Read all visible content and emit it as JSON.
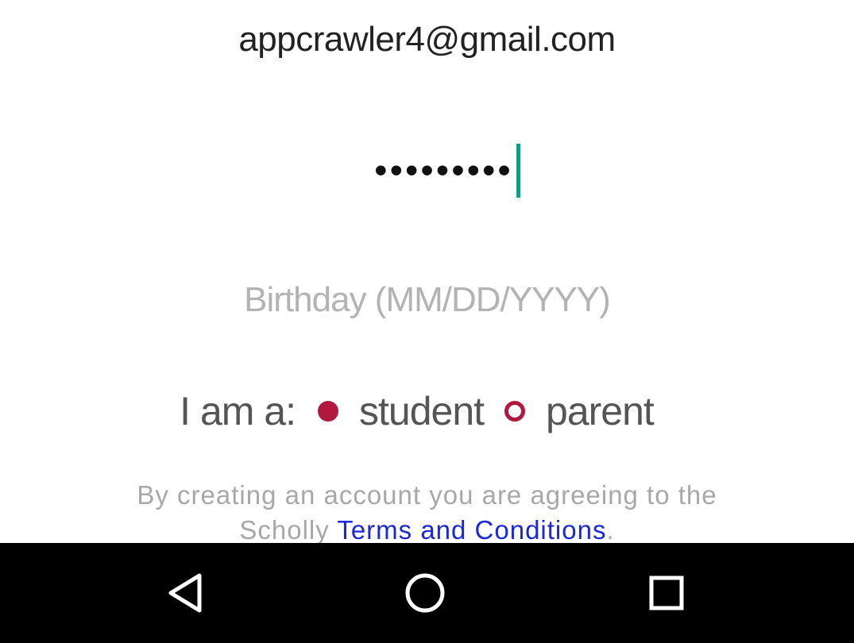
{
  "form": {
    "email_value": "appcrawler4@gmail.com",
    "password_mask": "•••••••••",
    "birthday_placeholder": "Birthday (MM/DD/YYYY)",
    "role_label": "I am a:",
    "role_options": [
      {
        "label": "student",
        "selected": true
      },
      {
        "label": "parent",
        "selected": false
      }
    ],
    "terms_prefix_line1": "By creating an account you are agreeing to the",
    "terms_prefix_line2": "Scholly ",
    "terms_link": "Terms and Conditions",
    "terms_suffix": "."
  },
  "colors": {
    "accent": "#b0183e",
    "caret": "#0f9d8a",
    "link": "#1a28d8",
    "navbar": "#000000"
  },
  "navbar": {
    "buttons": [
      {
        "icon": "back-triangle-icon"
      },
      {
        "icon": "home-circle-icon"
      },
      {
        "icon": "recents-square-icon"
      }
    ]
  }
}
